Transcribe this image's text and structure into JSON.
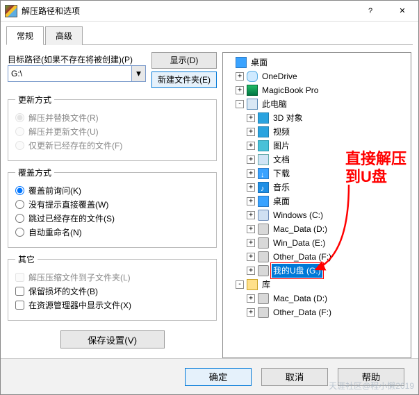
{
  "window": {
    "title": "解压路径和选项"
  },
  "tabs": [
    {
      "label": "常规",
      "active": true
    },
    {
      "label": "高级",
      "active": false
    }
  ],
  "path": {
    "label": "目标路径(如果不存在将被创建)(P)",
    "value": "G:\\"
  },
  "right_buttons": {
    "display": "显示(D)",
    "newfolder": "新建文件夹(E)"
  },
  "update_mode": {
    "legend": "更新方式",
    "options": [
      {
        "label": "解压并替换文件(R)",
        "type": "radio",
        "checked": true,
        "disabled": true
      },
      {
        "label": "解压并更新文件(U)",
        "type": "radio",
        "checked": false,
        "disabled": true
      },
      {
        "label": "仅更新已经存在的文件(F)",
        "type": "radio",
        "checked": false,
        "disabled": true
      }
    ]
  },
  "overwrite_mode": {
    "legend": "覆盖方式",
    "options": [
      {
        "label": "覆盖前询问(K)",
        "type": "radio",
        "checked": true
      },
      {
        "label": "没有提示直接覆盖(W)",
        "type": "radio",
        "checked": false
      },
      {
        "label": "跳过已经存在的文件(S)",
        "type": "radio",
        "checked": false
      },
      {
        "label": "自动重命名(N)",
        "type": "radio",
        "checked": false
      }
    ]
  },
  "misc": {
    "legend": "其它",
    "options": [
      {
        "label": "解压压缩文件到子文件夹(L)",
        "type": "checkbox",
        "checked": false,
        "disabled": true
      },
      {
        "label": "保留损坏的文件(B)",
        "type": "checkbox",
        "checked": false
      },
      {
        "label": "在资源管理器中显示文件(X)",
        "type": "checkbox",
        "checked": false
      }
    ]
  },
  "save_settings": "保存设置(V)",
  "tree": [
    {
      "depth": 0,
      "expander": "",
      "icon": "i-desktop",
      "label": "桌面"
    },
    {
      "depth": 1,
      "expander": "+",
      "icon": "i-cloud",
      "label": "OneDrive"
    },
    {
      "depth": 1,
      "expander": "+",
      "icon": "i-laptop",
      "label": "MagicBook Pro"
    },
    {
      "depth": 1,
      "expander": "-",
      "icon": "i-pc",
      "label": "此电脑"
    },
    {
      "depth": 2,
      "expander": "+",
      "icon": "i-3d",
      "label": "3D 对象"
    },
    {
      "depth": 2,
      "expander": "+",
      "icon": "i-video",
      "label": "视频"
    },
    {
      "depth": 2,
      "expander": "+",
      "icon": "i-pic",
      "label": "图片"
    },
    {
      "depth": 2,
      "expander": "+",
      "icon": "i-doc",
      "label": "文档"
    },
    {
      "depth": 2,
      "expander": "+",
      "icon": "i-dl",
      "label": "下载"
    },
    {
      "depth": 2,
      "expander": "+",
      "icon": "i-music",
      "label": "音乐"
    },
    {
      "depth": 2,
      "expander": "+",
      "icon": "i-desktop",
      "label": "桌面"
    },
    {
      "depth": 2,
      "expander": "+",
      "icon": "i-drivec",
      "label": "Windows (C:)"
    },
    {
      "depth": 2,
      "expander": "+",
      "icon": "i-drive",
      "label": "Mac_Data (D:)"
    },
    {
      "depth": 2,
      "expander": "+",
      "icon": "i-drive",
      "label": "Win_Data (E:)"
    },
    {
      "depth": 2,
      "expander": "+",
      "icon": "i-drive",
      "label": "Other_Data (F:)"
    },
    {
      "depth": 2,
      "expander": "+",
      "icon": "i-drive",
      "label": "我的U盘 (G:)",
      "selected": true
    },
    {
      "depth": 1,
      "expander": "-",
      "icon": "i-lib",
      "label": "库"
    },
    {
      "depth": 2,
      "expander": "+",
      "icon": "i-drive",
      "label": "Mac_Data (D:)"
    },
    {
      "depth": 2,
      "expander": "+",
      "icon": "i-drive",
      "label": "Other_Data (F:)"
    }
  ],
  "annotation": {
    "line1": "直接解压",
    "line2": "到U盘"
  },
  "buttons": {
    "ok": "确定",
    "cancel": "取消",
    "help": "帮助"
  },
  "watermark": "天涯社区@程小懒2019"
}
